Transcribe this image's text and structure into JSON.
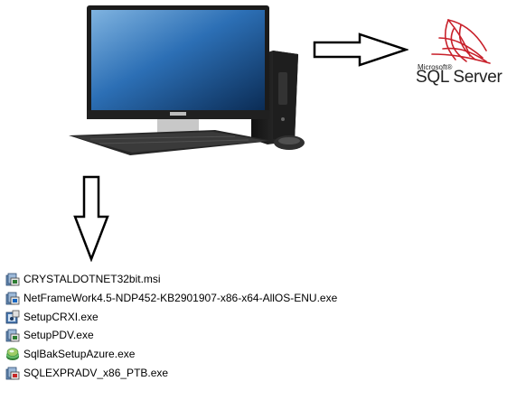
{
  "logo": {
    "company": "Microsoft®",
    "product": "SQL Server"
  },
  "files": [
    {
      "name": "CRYSTALDOTNET32bit.msi",
      "icon": "installer-package-icon"
    },
    {
      "name": "NetFrameWork4.5-NDP452-KB2901907-x86-x64-AllOS-ENU.exe",
      "icon": "installer-package-icon"
    },
    {
      "name": "SetupCRXI.exe",
      "icon": "setup-icon"
    },
    {
      "name": "SetupPDV.exe",
      "icon": "installer-package-icon"
    },
    {
      "name": "SqlBakSetupAzure.exe",
      "icon": "green-disc-icon"
    },
    {
      "name": "SQLEXPRADV_x86_PTB.exe",
      "icon": "installer-package-icon"
    }
  ],
  "colors": {
    "sql_red": "#c8202a",
    "monitor_frame": "#1b1b1b",
    "screen_blue": "#1f5a9a"
  }
}
